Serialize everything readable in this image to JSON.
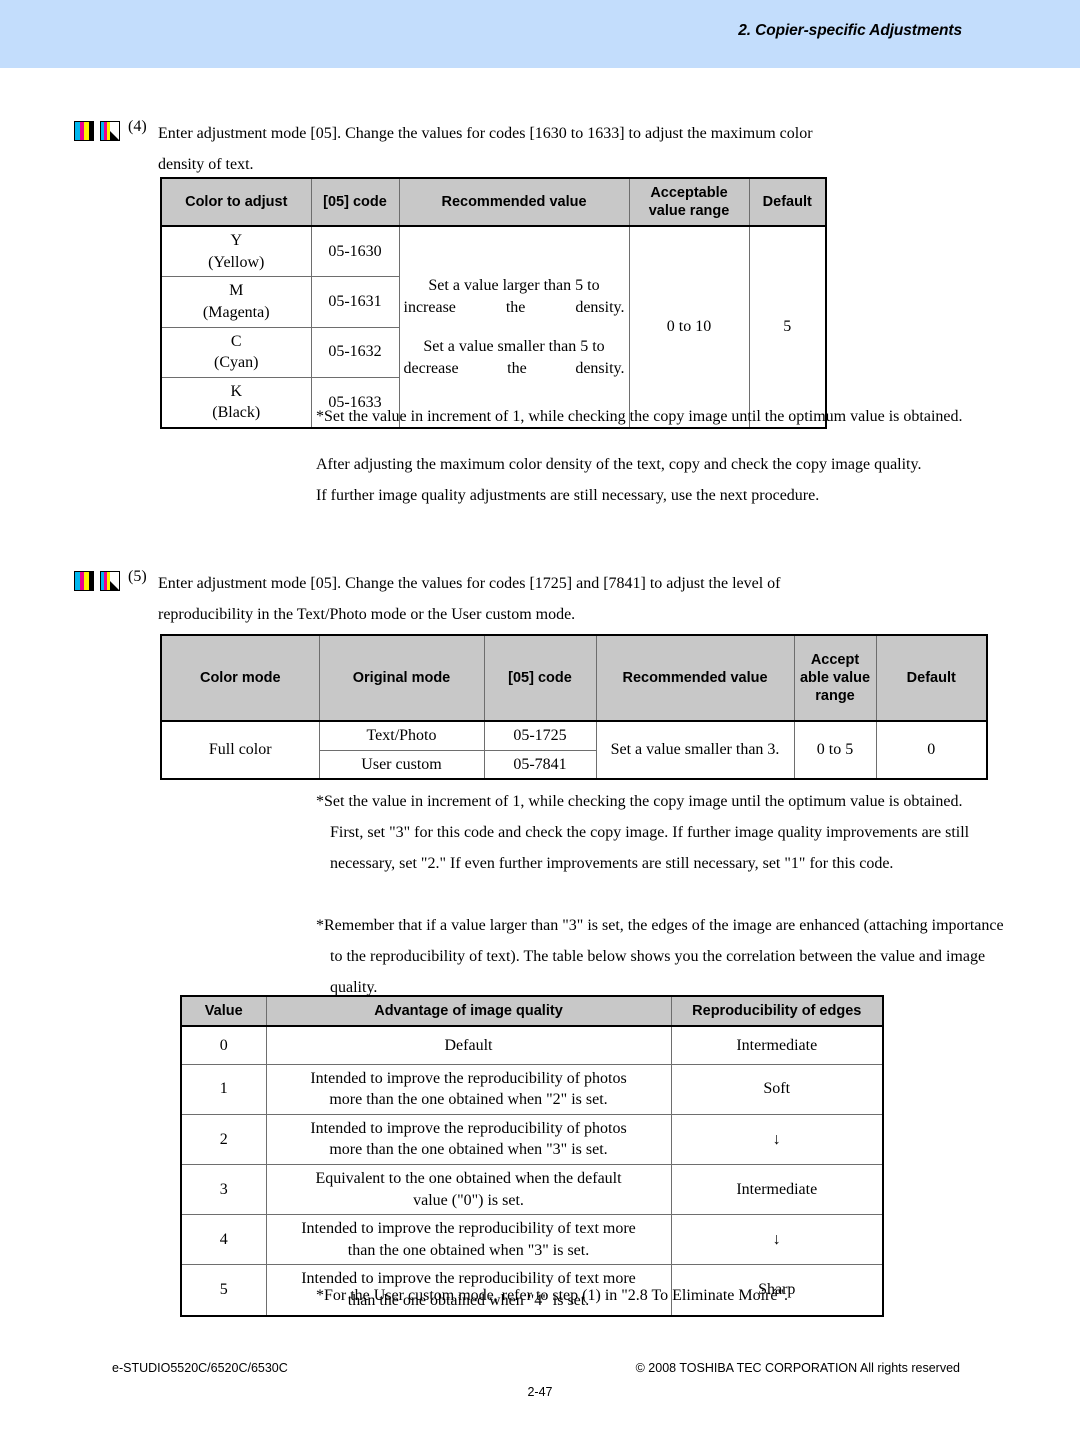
{
  "header": {
    "title": "2. Copier-specific Adjustments",
    "band_color": "#c3ddfc"
  },
  "steps": [
    {
      "number": "(4)",
      "line1": "Enter adjustment mode [05].  Change the values for codes [1630 to 1633] to adjust the maximum color",
      "line2": "density of text."
    },
    {
      "number": "(5)",
      "line1": "Enter adjustment mode [05]. Change the values for codes [1725] and [7841] to adjust the level of",
      "line2": "reproducibility in the Text/Photo mode or the User custom mode."
    }
  ],
  "table1": {
    "headers": [
      "Color to adjust",
      "[05] code",
      "Recommended value",
      "Acceptable value range",
      "Default"
    ],
    "rows": [
      {
        "color_letter": "Y",
        "color_name": "(Yellow)",
        "code": "05-1630"
      },
      {
        "color_letter": "M",
        "color_name": "(Magenta)",
        "code": "05-1631"
      },
      {
        "color_letter": "C",
        "color_name": "(Cyan)",
        "code": "05-1632"
      },
      {
        "color_letter": "K",
        "color_name": "(Black)",
        "code": "05-1633"
      }
    ],
    "recommended_line1": "Set a value larger than 5 to increase the density.",
    "recommended_line2": "Set a value smaller than 5 to decrease the density.",
    "range": "0 to 10",
    "default": "5"
  },
  "after_table1": {
    "note": "*Set the value in increment of 1, while checking the copy image until the optimum value is obtained.",
    "para1": "After adjusting the maximum color density of the text, copy and check the copy image quality.",
    "para2": "If further image quality adjustments are still necessary, use the next procedure."
  },
  "table2": {
    "headers": [
      "Color mode",
      "Original mode",
      "[05] code",
      "Recommended value",
      "Accept able value range",
      "Default"
    ],
    "color_mode": "Full color",
    "rows": [
      {
        "original_mode": "Text/Photo",
        "code": "05-1725"
      },
      {
        "original_mode": "User custom",
        "code": "05-7841"
      }
    ],
    "recommended": "Set a value smaller than 3.",
    "range": "0 to 5",
    "default": "0"
  },
  "after_table2": {
    "note_line1": "*Set the value in increment of 1, while checking the copy image until the optimum value is obtained.",
    "note_line2": "First, set \"3\" for this code and check the copy image.  If further image quality improvements are still",
    "note_line3": "necessary, set \"2.\"  If even further improvements are still necessary, set \"1\" for this code.",
    "remember_line1": "*Remember that if a value larger than \"3\" is set, the edges of the image are enhanced (attaching importance",
    "remember_line2": "to the reproducibility of text).  The table below shows you the correlation between the value and image",
    "remember_line3": "quality."
  },
  "table3": {
    "headers": [
      "Value",
      "Advantage of image quality",
      "Reproducibility of edges"
    ],
    "rows": [
      {
        "value": "0",
        "advantage_line1": "Default",
        "advantage_line2": "",
        "edges": "Intermediate"
      },
      {
        "value": "1",
        "advantage_line1": "Intended to improve the reproducibility of photos",
        "advantage_line2": "more than the one obtained when \"2\" is set.",
        "edges": "Soft"
      },
      {
        "value": "2",
        "advantage_line1": "Intended to improve the reproducibility of photos",
        "advantage_line2": "more than the one obtained when \"3\" is set.",
        "edges": "↓"
      },
      {
        "value": "3",
        "advantage_line1": "Equivalent to the one obtained when the default",
        "advantage_line2": "value (\"0\") is set.",
        "edges": "Intermediate"
      },
      {
        "value": "4",
        "advantage_line1": "Intended to improve the reproducibility of text more",
        "advantage_line2": "than the one obtained when \"3\" is set.",
        "edges": "↓"
      },
      {
        "value": "5",
        "advantage_line1": "Intended to improve the reproducibility of text more",
        "advantage_line2": "than the one obtained when \"4\" is set.",
        "edges": "Sharp"
      }
    ]
  },
  "final_note": "*For the User custom mode, refer to step (1) in \"2.8 To Eliminate Moiré\".",
  "footer": {
    "left": "e-STUDIO5520C/6520C/6530C",
    "right": "© 2008 TOSHIBA TEC CORPORATION All rights reserved",
    "page": "2-47"
  }
}
